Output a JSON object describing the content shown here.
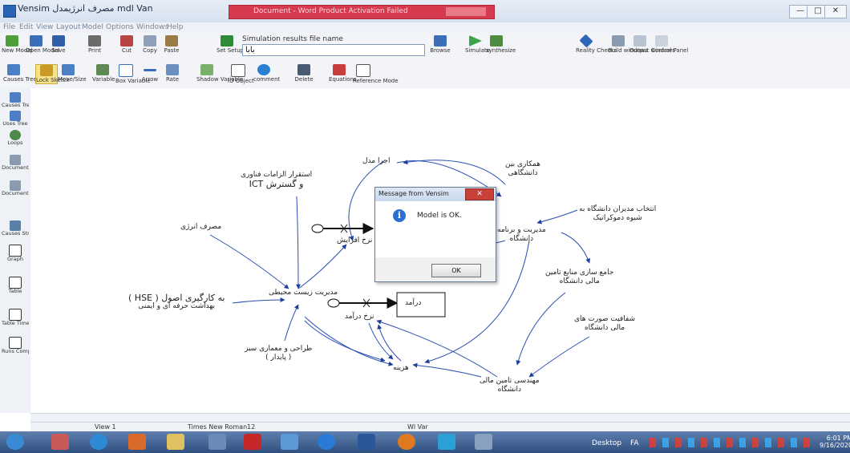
{
  "window": {
    "app_title": "Vensim",
    "title_rtl": "مصرف انرژیمدل ",
    "title_mid": "mdl Van",
    "redbar_text": "Document - Word Product Activation Failed",
    "controls": {
      "minimize": "—",
      "maximize": "□",
      "close": "✕"
    }
  },
  "menu": [
    "File",
    "Edit",
    "View",
    "Layout",
    "Model",
    "Options",
    "Windows",
    "Help"
  ],
  "toolbar1": {
    "tools": [
      {
        "label": "New Model",
        "icon": "new-model-icon"
      },
      {
        "label": "Open Model",
        "icon": "open-model-icon"
      },
      {
        "label": "Save",
        "icon": "save-icon"
      },
      {
        "label": "Print",
        "icon": "print-icon"
      },
      {
        "label": "Cut",
        "icon": "cut-icon"
      },
      {
        "label": "Copy",
        "icon": "copy-icon"
      },
      {
        "label": "Paste",
        "icon": "paste-icon"
      },
      {
        "label": "Set Setup",
        "icon": "setup-icon"
      }
    ],
    "sim_label": "Simulation results file name",
    "sim_value": "بابا",
    "right_tools": [
      {
        "label": "Browse",
        "icon": "browse-icon"
      },
      {
        "label": "Simulate",
        "icon": "simulate-icon"
      },
      {
        "label": "synthesize",
        "icon": "synthesize-icon"
      },
      {
        "label": "Reality Checks",
        "icon": "reality-check-icon"
      },
      {
        "label": "Build windows",
        "icon": "build-window-icon"
      },
      {
        "label": "Output windows",
        "icon": "output-window-icon"
      },
      {
        "label": "Control Panel",
        "icon": "control-panel-icon"
      }
    ]
  },
  "toolbar2": {
    "tools": [
      {
        "label": "Causes Tree",
        "icon": "causes-tree-icon"
      },
      {
        "label": "Lock Sketch",
        "icon": "lock-icon"
      },
      {
        "label": "Move/Size",
        "icon": "move-icon"
      },
      {
        "label": "Variable",
        "icon": "variable-icon"
      },
      {
        "label": "Box Variable",
        "icon": "box-variable-icon"
      },
      {
        "label": "Arrow",
        "icon": "arrow-icon"
      },
      {
        "label": "Rate",
        "icon": "rate-icon"
      },
      {
        "label": "Shadow Variable",
        "icon": "shadow-variable-icon"
      },
      {
        "label": "IO Object",
        "icon": "io-object-icon"
      },
      {
        "label": "comment",
        "icon": "comment-icon"
      },
      {
        "label": "Delete",
        "icon": "delete-icon"
      },
      {
        "label": "Equations",
        "icon": "equations-icon"
      },
      {
        "label": "Reference Mode",
        "icon": "reference-mode-icon"
      }
    ]
  },
  "lefttools": [
    {
      "label": "Causes Tree",
      "icon": "causes-tree-icon"
    },
    {
      "label": "Uses Tree",
      "icon": "uses-tree-icon"
    },
    {
      "label": "Loops",
      "icon": "loops-icon"
    },
    {
      "label": "Document",
      "icon": "document-icon"
    },
    {
      "label": "Document All",
      "icon": "document-all-icon"
    },
    {
      "label": "Causes Strip",
      "icon": "causes-strip-icon"
    },
    {
      "label": "Graph",
      "icon": "graph-icon"
    },
    {
      "label": "Table",
      "icon": "table-icon"
    },
    {
      "label": "Table Time Down",
      "icon": "table-time-icon"
    },
    {
      "label": "Runs Compare",
      "icon": "runs-compare-icon"
    }
  ],
  "diagram": {
    "v_stakeholder": "همکاری بین",
    "v_stakeholder2": "دانشگاهی",
    "v_exec": "اجرا مدل",
    "v_ict1": "استقرار الزامات فناوری",
    "v_ict2": "و گسترش ICT",
    "v_manager1": "انتخاب مدیران دانشگاه به",
    "v_manager2": "شیوه دموکراتیک",
    "v_energy": "مصرف انرژی",
    "v_rate": "نرخ افزایش",
    "v_planning1": "مدیریت و برنامه",
    "v_planning2": "دانشگاه",
    "v_fin1": "جامع سازی منابع تامین",
    "v_fin2": "مالی دانشگاه",
    "v_env": "مدیریت زیست محیطی",
    "v_hse1": "به کارگیری اصول ( HSE )",
    "v_hse2": "بهداشت حرفه ای و ایمنی",
    "v_income": "درآمد",
    "v_income_rate": "نرخ درآمد",
    "v_tuition1": "شفافیت صورت های",
    "v_tuition2": "مالی دانشگاه",
    "v_design1": "طراحی و معماری سبز",
    "v_design2": "( پایدار )",
    "v_cost": "هزینه",
    "v_monitor1": "مهندسی تامین مالی",
    "v_monitor2": "دانشگاه"
  },
  "dialog": {
    "title": "Message from Vensim",
    "close": "✕",
    "message": "Model is OK.",
    "ok_label": "OK",
    "icon": "info-icon"
  },
  "statusbar": {
    "view": "View 1",
    "font": "Times New Roman",
    "size": "12",
    "extra": "Wl Var"
  },
  "taskbar": {
    "apps": [
      "start-orb-icon",
      "media-icon",
      "browser-icon",
      "player-icon",
      "explorer-icon",
      "document-icon",
      "pdf-icon",
      "vensim-icon",
      "ie-icon",
      "word-icon",
      "firefox-icon",
      "app-icon",
      "tool-icon"
    ],
    "desktop": "Desktop",
    "lang": "FA",
    "time": "6:01 PM",
    "date": "9/16/2020"
  }
}
